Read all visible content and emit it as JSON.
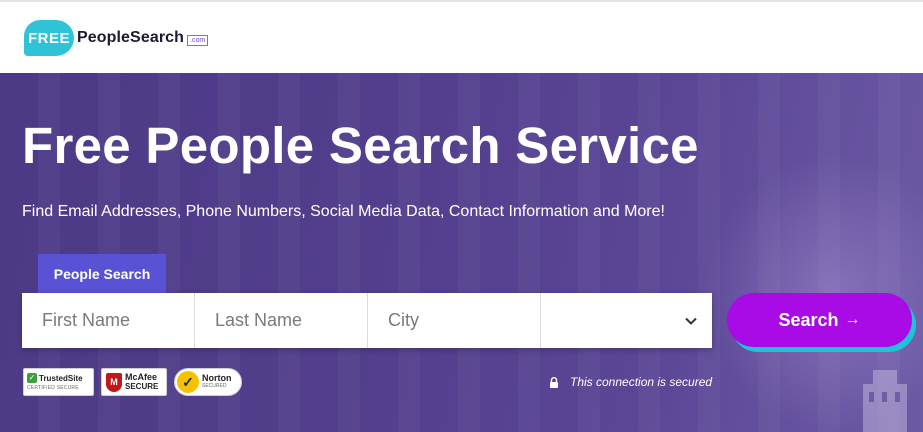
{
  "brand": {
    "logo_bubble": "FREE",
    "logo_text": "PeopleSearch",
    "logo_suffix": ".com"
  },
  "hero": {
    "title": "Free People Search Service",
    "subtitle": "Find Email Addresses, Phone Numbers, Social Media Data, Contact Information and More!",
    "tab_label": "People Search"
  },
  "search": {
    "first_name_placeholder": "First Name",
    "last_name_placeholder": "Last Name",
    "city_placeholder": "City",
    "state_selected": "",
    "button_label": "Search",
    "button_arrow": "→"
  },
  "badges": {
    "trusted_name": "TrustedSite",
    "trusted_sub": "CERTIFIED SECURE",
    "mcafee_name": "McAfee",
    "mcafee_secure": "SECURE",
    "norton_name": "Norton",
    "norton_secured": "SECURED"
  },
  "security_note": "This connection is secured",
  "colors": {
    "hero_purple": "#533f8d",
    "tab_blue": "#5a52d5",
    "button_purple": "#a80be6",
    "button_shadow_cyan": "#1ec3d6",
    "logo_cyan": "#2ec3d6"
  }
}
